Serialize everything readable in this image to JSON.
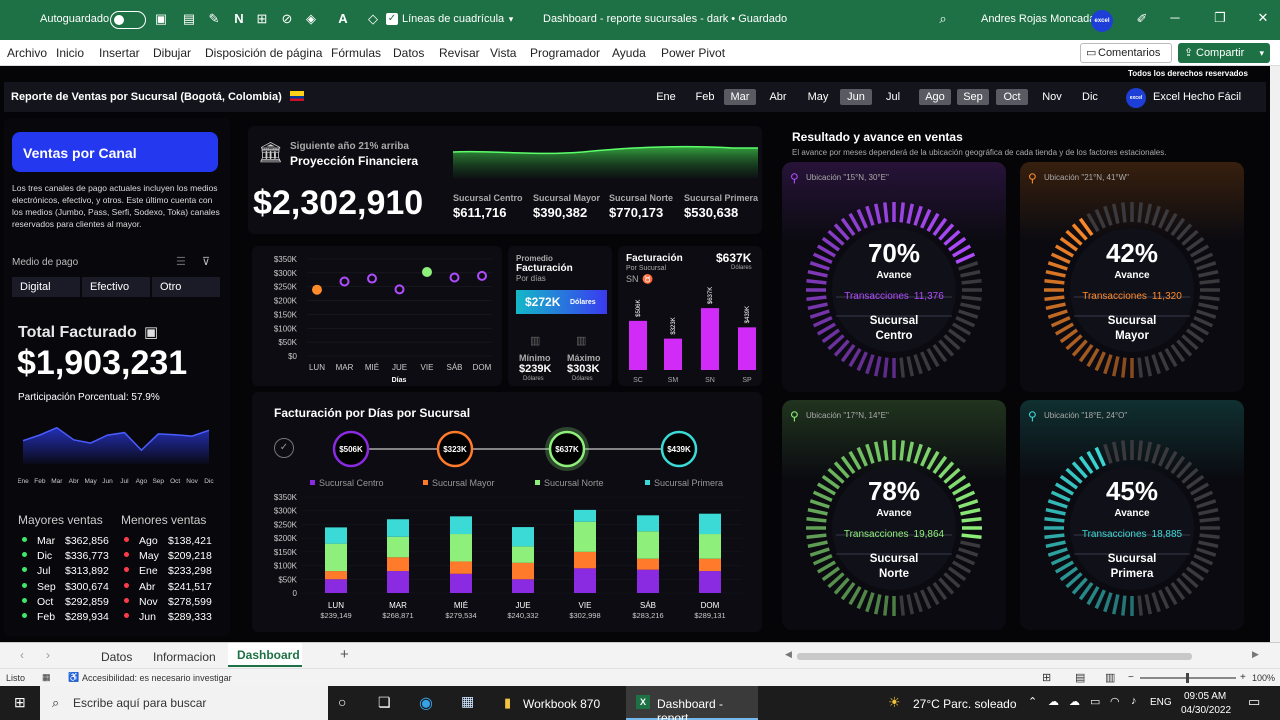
{
  "titlebar": {
    "autosave": "Autoguardado",
    "gridlines": "Líneas de cuadrícula",
    "doc_title": "Dashboard - reporte sucursales - dark • Guardado",
    "user": "Andres Rojas Moncada",
    "avatar_text": "excel"
  },
  "menu": [
    "Archivo",
    "Inicio",
    "Insertar",
    "Dibujar",
    "Disposición de página",
    "Fórmulas",
    "Datos",
    "Revisar",
    "Vista",
    "Programador",
    "Ayuda",
    "Power Pivot"
  ],
  "comments_label": "Comentarios",
  "share_label": "Compartir",
  "rights": "Todos los derechos reservados",
  "header": {
    "title": "Reporte de Ventas por Sucursal (Bogotá, Colombia)",
    "months": [
      "Ene",
      "Feb",
      "Mar",
      "Abr",
      "May",
      "Jun",
      "Jul",
      "Ago",
      "Sep",
      "Oct",
      "Nov",
      "Dic"
    ],
    "selected_months": [
      "Mar",
      "Jun",
      "Ago",
      "Sep",
      "Oct"
    ],
    "brand": "Excel Hecho Fácil"
  },
  "left": {
    "channel_title": "Ventas por Canal",
    "channel_desc": "Los tres canales de pago actuales incluyen los medios electrónicos, efectivo, y otros. Este último cuenta con los medios (Jumbo, Pass, Serfi, Sodexo, Toka) canales reservados para clientes al mayor.",
    "payment_label": "Medio de pago",
    "payment_options": [
      "Digital",
      "Efectivo",
      "Otro"
    ],
    "total_label": "Total Facturado",
    "total_value": "$1,903,231",
    "participation": "Participación Porcentual: 57.9%",
    "spark_months": [
      "Ene",
      "Feb",
      "Mar",
      "Abr",
      "May",
      "Jun",
      "Jul",
      "Ago",
      "Sep",
      "Oct",
      "Nov",
      "Dic"
    ],
    "best_label": "Mayores ventas",
    "worst_label": "Menores ventas",
    "best": [
      [
        "Mar",
        "$362,856"
      ],
      [
        "Dic",
        "$336,773"
      ],
      [
        "Jul",
        "$313,892"
      ],
      [
        "Sep",
        "$300,674"
      ],
      [
        "Oct",
        "$292,859"
      ],
      [
        "Feb",
        "$289,934"
      ]
    ],
    "worst": [
      [
        "Ago",
        "$138,421"
      ],
      [
        "May",
        "$209,218"
      ],
      [
        "Ene",
        "$233,298"
      ],
      [
        "Abr",
        "$241,517"
      ],
      [
        "Nov",
        "$278,599"
      ],
      [
        "Jun",
        "$289,333"
      ]
    ]
  },
  "projection": {
    "subtitle": "Siguiente año 21% arriba",
    "title": "Proyección Financiera",
    "value": "$2,302,910",
    "branches": [
      {
        "label": "Sucursal Centro",
        "value": "$611,716"
      },
      {
        "label": "Sucursal Mayor",
        "value": "$390,382"
      },
      {
        "label": "Sucursal Norte",
        "value": "$770,173"
      },
      {
        "label": "Sucursal Primera",
        "value": "$530,638"
      }
    ]
  },
  "avg": {
    "label1": "Promedio",
    "label2": "Facturación",
    "label3": "Por días",
    "value": "$272K",
    "unit": "Dólares",
    "min_label": "Mínimo",
    "min_value": "$239K",
    "max_label": "Máximo",
    "max_value": "$303K",
    "unit_small": "Dólares"
  },
  "fact_branch": {
    "title": "Facturación",
    "subtitle": "Por Sucursal",
    "sub2": "SN",
    "value": "$637K",
    "unit": "Dólares"
  },
  "daily": {
    "title": "Facturación por Días por Sucursal",
    "legend": [
      "Sucursal Centro",
      "Sucursal Mayor",
      "Sucursal Norte",
      "Sucursal Primera"
    ],
    "circles": [
      "$506K",
      "$323K",
      "$637K",
      "$439K"
    ],
    "days": [
      "LUN",
      "MAR",
      "MIÉ",
      "JUE",
      "VIE",
      "SÁB",
      "DOM"
    ],
    "day_totals": [
      "$239,149",
      "$268,871",
      "$279,534",
      "$240,332",
      "$302,998",
      "$283,216",
      "$289,131"
    ]
  },
  "results": {
    "title": "Resultado y avance en ventas",
    "desc": "El avance por meses dependerá de la ubicación geográfica de cada tienda y de los factores estacionales.",
    "gauges": [
      {
        "loc": "Ubicación \"15°N, 30°E\"",
        "pct": "70%",
        "progress": 0.7,
        "avance": "Avance",
        "trans": "Transacciones",
        "trans_value": "11,376",
        "name1": "Sucursal",
        "name2": "Centro",
        "color": "#b04cff"
      },
      {
        "loc": "Ubicación \"21°N, 41°W\"",
        "pct": "42%",
        "progress": 0.42,
        "avance": "Avance",
        "trans": "Transacciones",
        "trans_value": "11,320",
        "name1": "Sucursal",
        "name2": "Mayor",
        "color": "#ff8a2b"
      },
      {
        "loc": "Ubicación \"17°N, 14°E\"",
        "pct": "78%",
        "progress": 0.78,
        "avance": "Avance",
        "trans": "Transacciones",
        "trans_value": "19,864",
        "name1": "Sucursal",
        "name2": "Norte",
        "color": "#8ef07a"
      },
      {
        "loc": "Ubicación \"18°E, 24°O\"",
        "pct": "45%",
        "progress": 0.45,
        "avance": "Avance",
        "trans": "Transacciones",
        "trans_value": "18,885",
        "name1": "Sucursal",
        "name2": "Primera",
        "color": "#3bdad6"
      }
    ]
  },
  "tabs": [
    "Datos",
    "Informacion",
    "Dashboard"
  ],
  "active_tab": "Dashboard",
  "status": {
    "ready": "Listo",
    "accessibility": "Accesibilidad: es necesario investigar",
    "zoom": "100%"
  },
  "taskbar": {
    "search": "Escribe aquí para buscar",
    "app1": "Workbook 870",
    "app2": "Dashboard - report...",
    "weather": "27°C  Parc. soleado",
    "lang": "ENG",
    "time": "09:05 AM",
    "date": "04/30/2022"
  },
  "chart_data": [
    {
      "type": "scatter",
      "title": "",
      "categories": [
        "LUN",
        "MAR",
        "MIÉ",
        "JUE",
        "VIE",
        "SÁB",
        "DOM"
      ],
      "values": [
        239149,
        268871,
        279534,
        240332,
        302998,
        283216,
        289131
      ],
      "xlabel": "Días",
      "ylabel": "",
      "yticks": [
        "$0",
        "$50K",
        "$100K",
        "$150K",
        "$200K",
        "$250K",
        "$300K",
        "$350K"
      ],
      "ylim": [
        0,
        350000
      ]
    },
    {
      "type": "bar",
      "title": "Facturación Por Sucursal",
      "categories": [
        "SC",
        "SM",
        "SN",
        "SP"
      ],
      "values": [
        506000,
        323000,
        637000,
        439000
      ],
      "labels": [
        "$506K",
        "$323K",
        "$637K",
        "$439K"
      ]
    },
    {
      "type": "bar",
      "stacked": true,
      "title": "Facturación por Días por Sucursal",
      "categories": [
        "LUN",
        "MAR",
        "MIÉ",
        "JUE",
        "VIE",
        "SÁB",
        "DOM"
      ],
      "series": [
        {
          "name": "Sucursal Centro",
          "values": [
            50000,
            80000,
            70000,
            50000,
            90000,
            85000,
            80000
          ]
        },
        {
          "name": "Sucursal Mayor",
          "values": [
            30000,
            50000,
            45000,
            60000,
            60000,
            40000,
            45000
          ]
        },
        {
          "name": "Sucursal Norte",
          "values": [
            100000,
            75000,
            100000,
            60000,
            110000,
            100000,
            90000
          ]
        },
        {
          "name": "Sucursal Primera",
          "values": [
            59149,
            63871,
            64534,
            70332,
            42998,
            58216,
            74131
          ]
        }
      ],
      "colors": [
        "#8a2be2",
        "#ff7a2b",
        "#8ef07a",
        "#3bdad6"
      ],
      "yticks": [
        "0",
        "$50K",
        "$100K",
        "$150K",
        "$200K",
        "$250K",
        "$300K",
        "$350K"
      ],
      "ylim": [
        0,
        350000
      ]
    },
    {
      "type": "area",
      "title": "",
      "categories": [
        "Ene",
        "Feb",
        "Mar",
        "Abr",
        "May",
        "Jun",
        "Jul",
        "Ago",
        "Sep",
        "Oct",
        "Nov",
        "Dic"
      ],
      "values": [
        233298,
        289934,
        362856,
        241517,
        209218,
        289333,
        313892,
        138421,
        300674,
        292859,
        278599,
        336773
      ]
    }
  ]
}
